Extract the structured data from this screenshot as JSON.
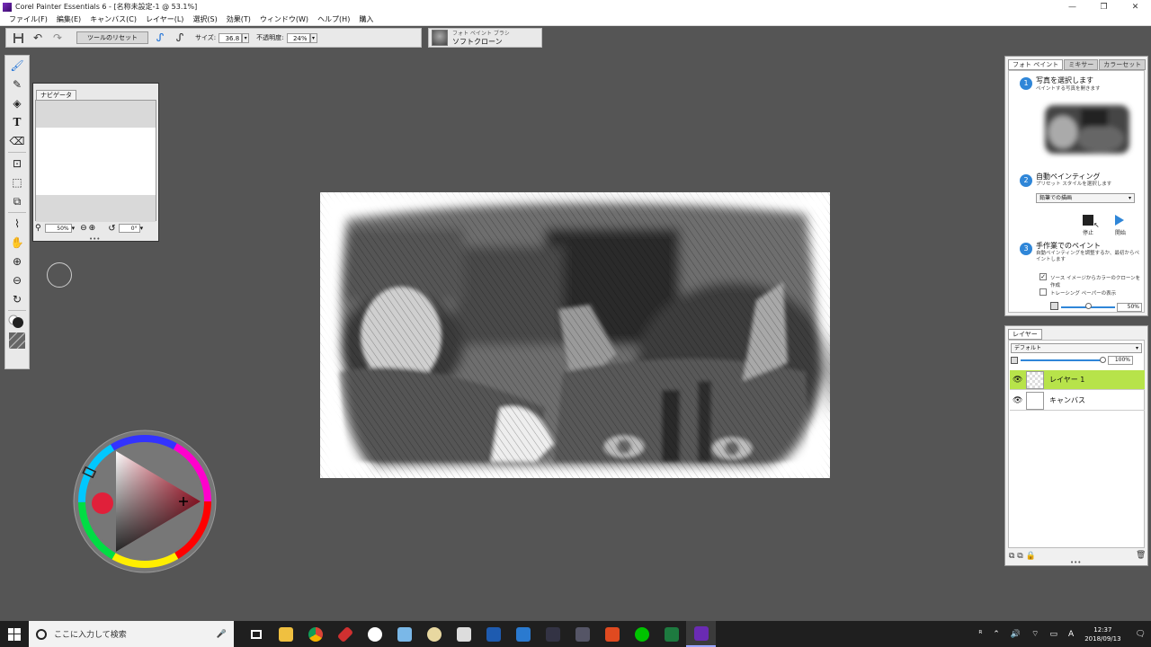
{
  "window": {
    "title": "Corel Painter Essentials 6 - [名称未設定-1 @ 53.1%]",
    "minimize": "—",
    "maximize": "❐",
    "close": "✕"
  },
  "menu": [
    "ファイル(F)",
    "編集(E)",
    "キャンバス(C)",
    "レイヤー(L)",
    "選択(S)",
    "効果(T)",
    "ウィンドウ(W)",
    "ヘルプ(H)",
    "購入"
  ],
  "propbar": {
    "reset_label": "ツールのリセット",
    "size_label": "サイズ:",
    "size_value": "36.8",
    "opacity_label": "不透明度:",
    "opacity_value": "24%"
  },
  "brush": {
    "category": "フォト ペイント ブラシ",
    "variant": "ソフトクローン"
  },
  "navigator": {
    "tab": "ナビゲータ",
    "zoom": "50%",
    "rotation": "0°"
  },
  "photopaint": {
    "tabs": [
      "フォト ペイント",
      "ミキサー",
      "カラーセット"
    ],
    "step1_num": "1",
    "step1_title": "写真を選択します",
    "step1_sub": "ペイントする写真を開きます",
    "step2_num": "2",
    "step2_title": "自動ペインティング",
    "step2_sub": "プリセット スタイルを選択します",
    "preset": "鉛筆での描画",
    "stop_label": "停止",
    "start_label": "開始",
    "step3_num": "3",
    "step3_title": "手作業でのペイント",
    "step3_sub": "自動ペインティングを調整するか、最初からペイントします",
    "check1": "ソース イメージからカラーのクローンを作成",
    "check2": "トレーシング ペーパーの表示",
    "tracing_value": "50%"
  },
  "layers": {
    "tab": "レイヤー",
    "composite": "デフォルト",
    "opacity": "100%",
    "items": [
      {
        "name": "レイヤー 1"
      },
      {
        "name": "キャンバス"
      }
    ]
  },
  "taskbar": {
    "search_placeholder": "ここに入力して検索",
    "ime": "A",
    "time": "12:37",
    "date": "2018/09/13"
  },
  "colors": {
    "accent_blue": "#2f86d8",
    "layer_selected": "#b7e34a",
    "current_color": "#e0203a"
  }
}
